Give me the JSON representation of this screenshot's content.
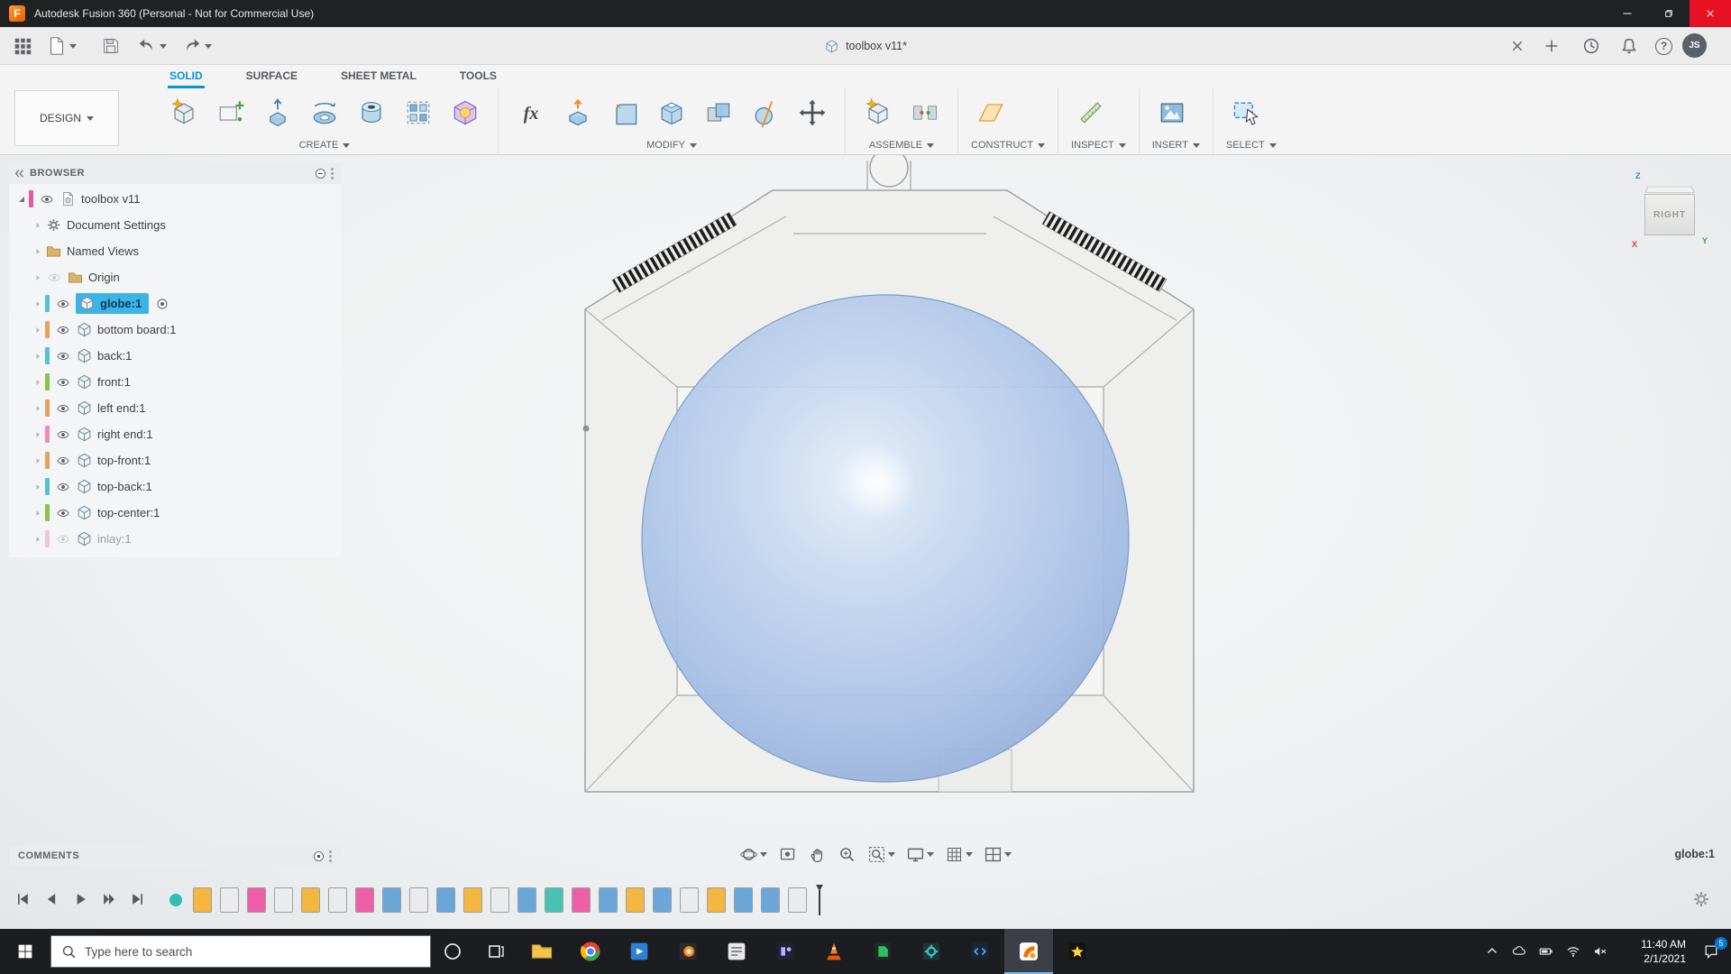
{
  "titlebar": {
    "title": "Autodesk Fusion 360 (Personal - Not for Commercial Use)",
    "logo_letter": "F"
  },
  "qat": {
    "doc_tab": "toolbox v11*",
    "avatar_initials": "JS",
    "help_glyph": "?",
    "left_tools": [
      {
        "name": "data-panel-toggle",
        "caret": false
      },
      {
        "name": "file-menu",
        "caret": true
      },
      {
        "name": "save",
        "caret": false
      },
      {
        "name": "undo",
        "caret": true
      },
      {
        "name": "redo",
        "caret": true
      }
    ]
  },
  "ribbon": {
    "tabs": [
      {
        "label": "SOLID",
        "active": true
      },
      {
        "label": "SURFACE",
        "active": false
      },
      {
        "label": "SHEET METAL",
        "active": false
      },
      {
        "label": "TOOLS",
        "active": false
      }
    ],
    "design_label": "DESIGN",
    "fx_glyph": "fx",
    "groups": [
      {
        "label": "CREATE",
        "tools": [
          "new-component",
          "create-sketch",
          "extrude",
          "revolve",
          "hole",
          "pattern",
          "form"
        ]
      },
      {
        "label": "MODIFY",
        "tools": [
          "parameters",
          "press-pull",
          "fillet",
          "shell",
          "combine",
          "split-body",
          "move"
        ]
      },
      {
        "label": "ASSEMBLE",
        "tools": [
          "new-component",
          "joint"
        ]
      },
      {
        "label": "CONSTRUCT",
        "tools": [
          "plane"
        ]
      },
      {
        "label": "INSPECT",
        "tools": [
          "measure"
        ]
      },
      {
        "label": "INSERT",
        "tools": [
          "insert-canvas"
        ]
      },
      {
        "label": "SELECT",
        "tools": [
          "select"
        ]
      }
    ]
  },
  "browser": {
    "header": "BROWSER",
    "items": [
      {
        "label": "toolbox v11",
        "kind": "root",
        "bar": "#e558a2",
        "eye": "on",
        "selected": false,
        "dimmed": false
      },
      {
        "label": "Document Settings",
        "kind": "settings",
        "bar": null,
        "eye": null,
        "selected": false,
        "dimmed": false
      },
      {
        "label": "Named Views",
        "kind": "folder",
        "bar": null,
        "eye": null,
        "selected": false,
        "dimmed": false
      },
      {
        "label": "Origin",
        "kind": "folder",
        "bar": null,
        "eye": "off",
        "selected": false,
        "dimmed": false
      },
      {
        "label": "globe:1",
        "kind": "component",
        "bar": "#56c1d6",
        "eye": "on",
        "selected": true,
        "dimmed": false
      },
      {
        "label": "bottom board:1",
        "kind": "component",
        "bar": "#e5a05b",
        "eye": "on",
        "selected": false,
        "dimmed": false
      },
      {
        "label": "back:1",
        "kind": "component",
        "bar": "#56c1d6",
        "eye": "on",
        "selected": false,
        "dimmed": false
      },
      {
        "label": "front:1",
        "kind": "component",
        "bar": "#8bc34a",
        "eye": "on",
        "selected": false,
        "dimmed": false
      },
      {
        "label": "left end:1",
        "kind": "component",
        "bar": "#e5a05b",
        "eye": "on",
        "selected": false,
        "dimmed": false
      },
      {
        "label": "right end:1",
        "kind": "component",
        "bar": "#f08bb4",
        "eye": "on",
        "selected": false,
        "dimmed": false
      },
      {
        "label": "top-front:1",
        "kind": "component",
        "bar": "#e5a05b",
        "eye": "on",
        "selected": false,
        "dimmed": false
      },
      {
        "label": "top-back:1",
        "kind": "component",
        "bar": "#56c1d6",
        "eye": "on",
        "selected": false,
        "dimmed": false
      },
      {
        "label": "top-center:1",
        "kind": "component",
        "bar": "#8bc34a",
        "eye": "on",
        "selected": false,
        "dimmed": false
      },
      {
        "label": "inlay:1",
        "kind": "component",
        "bar": "#f08bb4",
        "eye": "off",
        "selected": false,
        "dimmed": true
      }
    ]
  },
  "viewcube": {
    "face_label": "RIGHT",
    "axis_z": "Z",
    "axis_y": "Y",
    "axis_x": "X"
  },
  "comments": {
    "header": "COMMENTS"
  },
  "status": {
    "selection": "globe:1"
  },
  "navbar": {
    "tools": [
      {
        "name": "orbit",
        "caret": true
      },
      {
        "name": "look-at",
        "caret": false
      },
      {
        "name": "pan",
        "caret": false
      },
      {
        "name": "zoom",
        "caret": false
      },
      {
        "name": "fit",
        "caret": true
      },
      {
        "name": "display-settings",
        "caret": true
      },
      {
        "name": "grid-display",
        "caret": true
      },
      {
        "name": "viewports",
        "caret": true
      }
    ]
  },
  "timeline": {
    "playback": [
      "skip-start",
      "step-back",
      "play",
      "step-forward",
      "skip-end"
    ],
    "marker_color": "#2fbfae",
    "items": [
      "#f3b63f",
      "#e9ebed",
      "#ef5fa7",
      "#e9ebed",
      "#f3b63f",
      "#e9ebed",
      "#ef5fa7",
      "#6aa7d8",
      "#e9ebed",
      "#6aa7d8",
      "#f3b63f",
      "#e9ebed",
      "#6aa7d8",
      "#49c3b1",
      "#ef5fa7",
      "#6aa7d8",
      "#f3b63f",
      "#6aa7d8",
      "#e9ebed",
      "#f3b63f",
      "#6aa7d8",
      "#6aa7d8",
      "#e9ebed"
    ]
  },
  "taskbar": {
    "search_placeholder": "Type here to search",
    "apps": [
      {
        "name": "file-explorer",
        "active": false
      },
      {
        "name": "chrome",
        "active": false
      },
      {
        "name": "app-blue-media",
        "active": false
      },
      {
        "name": "app-dark-orange",
        "active": false
      },
      {
        "name": "app-light-notes",
        "active": false
      },
      {
        "name": "app-dark-blue",
        "active": false
      },
      {
        "name": "vlc",
        "active": false
      },
      {
        "name": "app-green",
        "active": false
      },
      {
        "name": "app-teal-gear",
        "active": false
      },
      {
        "name": "app-code",
        "active": false
      },
      {
        "name": "fusion-360",
        "active": true
      },
      {
        "name": "app-star",
        "active": false
      }
    ],
    "time": "11:40 AM",
    "date": "2/1/2021",
    "notification_count": "5"
  }
}
